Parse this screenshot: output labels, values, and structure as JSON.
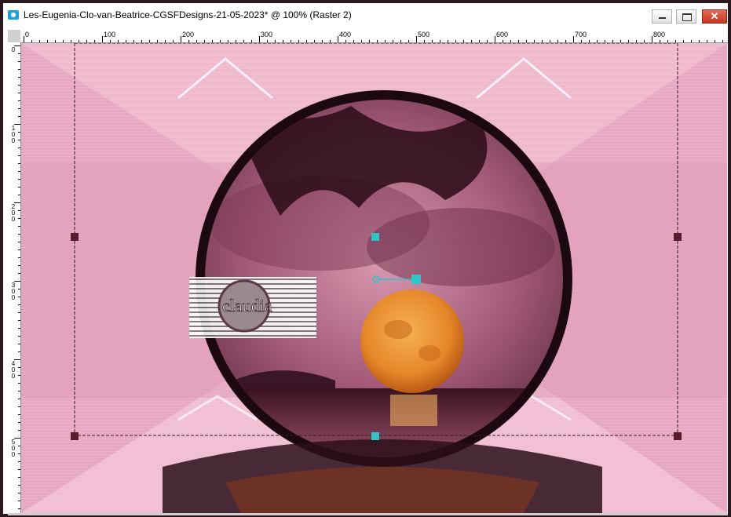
{
  "window": {
    "title": "Les-Eugenia-Clo-van-Beatrice-CGSFDesigns-21-05-2023* @ 100% (Raster 2)",
    "close_glyph": "✕"
  },
  "ruler_h_labels": [
    "0",
    "100",
    "200",
    "300",
    "400",
    "500",
    "600",
    "700",
    "800"
  ],
  "ruler_v_labels": [
    "0",
    "100",
    "200",
    "300",
    "400",
    "500"
  ],
  "watermark": {
    "text": "claudia"
  },
  "colors": {
    "canvas_pink": "#e9aac4",
    "frame_dark": "#1c0810",
    "moon": "#e98a26",
    "handle_cyan": "#2ec4c8",
    "handle_dark": "#5a1a2e"
  },
  "icons": [
    "app-icon",
    "minimize-icon",
    "maximize-icon",
    "close-icon"
  ]
}
